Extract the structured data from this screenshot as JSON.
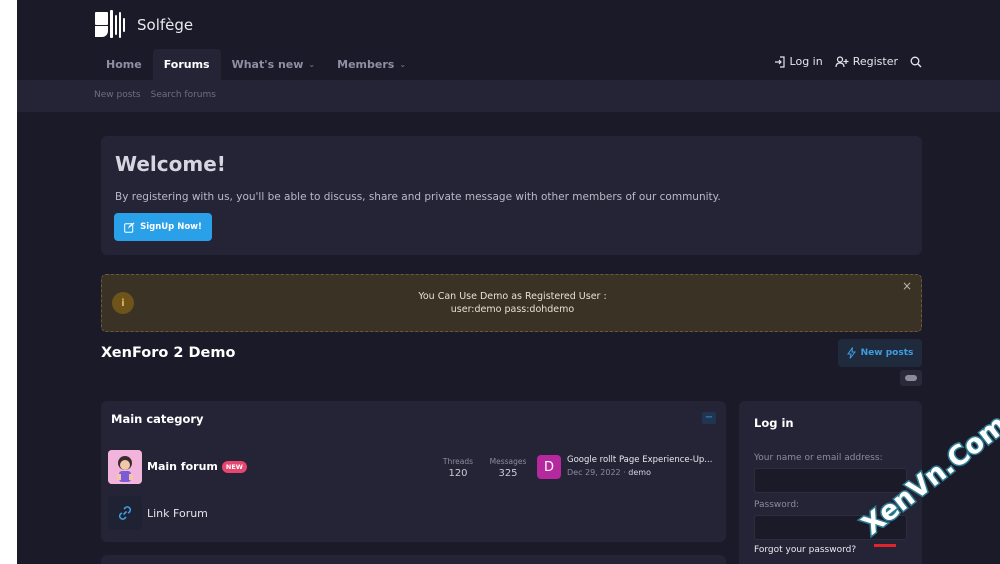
{
  "brand": {
    "name": "Solfège"
  },
  "nav": {
    "tabs": [
      {
        "label": "Home"
      },
      {
        "label": "Forums"
      },
      {
        "label": "What's new"
      },
      {
        "label": "Members"
      }
    ],
    "login_label": "Log in",
    "register_label": "Register"
  },
  "subnav": {
    "items": [
      {
        "label": "New posts"
      },
      {
        "label": "Search forums"
      }
    ]
  },
  "welcome": {
    "title": "Welcome!",
    "text": "By registering with us, you'll be able to discuss, share and private message with other members of our community.",
    "button_label": "SignUp Now!"
  },
  "notice": {
    "badge": "i",
    "line1": "You Can Use Demo as Registered User :",
    "line2": "user:demo pass:dohdemo",
    "close": "×"
  },
  "page": {
    "title": "XenForo 2 Demo",
    "new_posts_label": "New posts"
  },
  "category": {
    "title": "Main category",
    "collapse": "−",
    "forums": [
      {
        "name": "Main forum",
        "tag": "NEW",
        "threads_label": "Threads",
        "threads": "120",
        "messages_label": "Messages",
        "messages": "325",
        "last_avatar": "D",
        "last_title": "Google rollt Page Experience-Up...",
        "last_date": "Dec 29, 2022 · ",
        "last_user": "demo"
      },
      {
        "name": "Link Forum"
      }
    ]
  },
  "login": {
    "title": "Log in",
    "name_label": "Your name or email address:",
    "password_label": "Password:",
    "forgot": "Forgot your password?"
  },
  "watermark": {
    "text": "XenVn.Com"
  },
  "colors": {
    "background": "#1b1a28",
    "panel": "#252436",
    "accent": "#2aa0e8",
    "new_tag": "#e7466f"
  }
}
